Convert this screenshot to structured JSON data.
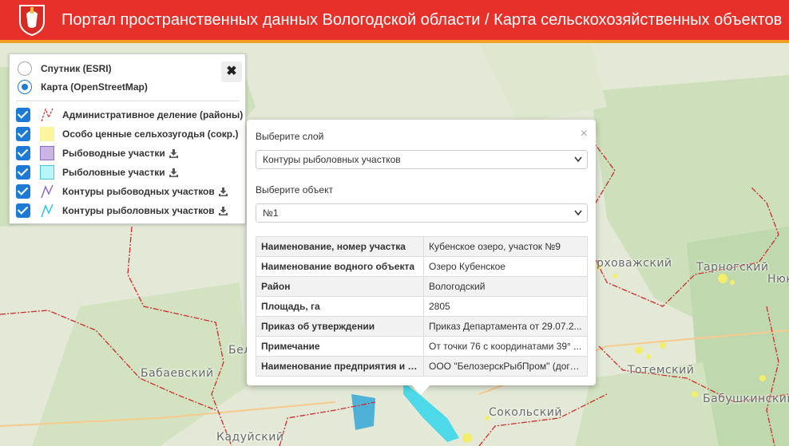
{
  "header": {
    "title": "Портал пространственных данных Вологодской области / Карта сельскохозяйственных объектов",
    "bg_color": "#e8302b",
    "accent_color": "#f2a024",
    "logo_icon": "coat-of-arms-icon"
  },
  "basemaps": [
    {
      "label": "Спутник (ESRI)",
      "selected": false
    },
    {
      "label": "Карта (OpenStreetMap)",
      "selected": true
    }
  ],
  "layers": [
    {
      "label": "Административное деление (районы)",
      "checked": true,
      "legend": "red-dashed-line",
      "download": false
    },
    {
      "label": "Особо ценные сельхозугодья (сокр.)",
      "checked": true,
      "legend": "yellow-fill",
      "download": false
    },
    {
      "label": "Рыбоводные участки",
      "checked": true,
      "legend": "purple-fill",
      "download": true
    },
    {
      "label": "Рыболовные участки",
      "checked": true,
      "legend": "cyan-fill",
      "download": true
    },
    {
      "label": "Контуры рыбоводных участков",
      "checked": true,
      "legend": "purple-line",
      "download": true
    },
    {
      "label": "Контуры рыболовных участков",
      "checked": true,
      "legend": "cyan-line",
      "download": true
    }
  ],
  "panel": {
    "close_symbol": "✖"
  },
  "popup": {
    "close_symbol": "×",
    "layer_label": "Выберите слой",
    "layer_value": "Контуры рыболовных участков",
    "object_label": "Выберите объект",
    "object_value": "№1",
    "rows": [
      {
        "key": "Наименование, номер участка",
        "value": "Кубенское озеро, участок №9"
      },
      {
        "key": "Наименование водного объекта",
        "value": "Озеро Кубенское"
      },
      {
        "key": "Район",
        "value": "Вологодский"
      },
      {
        "key": "Площадь, га",
        "value": "2805"
      },
      {
        "key": "Приказ об утверждении",
        "value": "Приказ Департамента от 29.07.2..."
      },
      {
        "key": "Примечание",
        "value": "От точки 76 с координатами 39° ..."
      },
      {
        "key": "Наименование предприятия и р...",
        "value": "ООО \"БелозерскРыбПром\" (дого..."
      }
    ]
  },
  "map_labels": {
    "babaevsky": "Бабаевский",
    "kaduisky": "Кадуйский",
    "bel": "Бел",
    "kharovazh": "рховажский",
    "tarnogsky": "Тарногский",
    "nyuk": "Нюк",
    "totemsky": "Тотемский",
    "babushkinsky": "Бабушкинский",
    "sokolsky": "Сокольский"
  }
}
